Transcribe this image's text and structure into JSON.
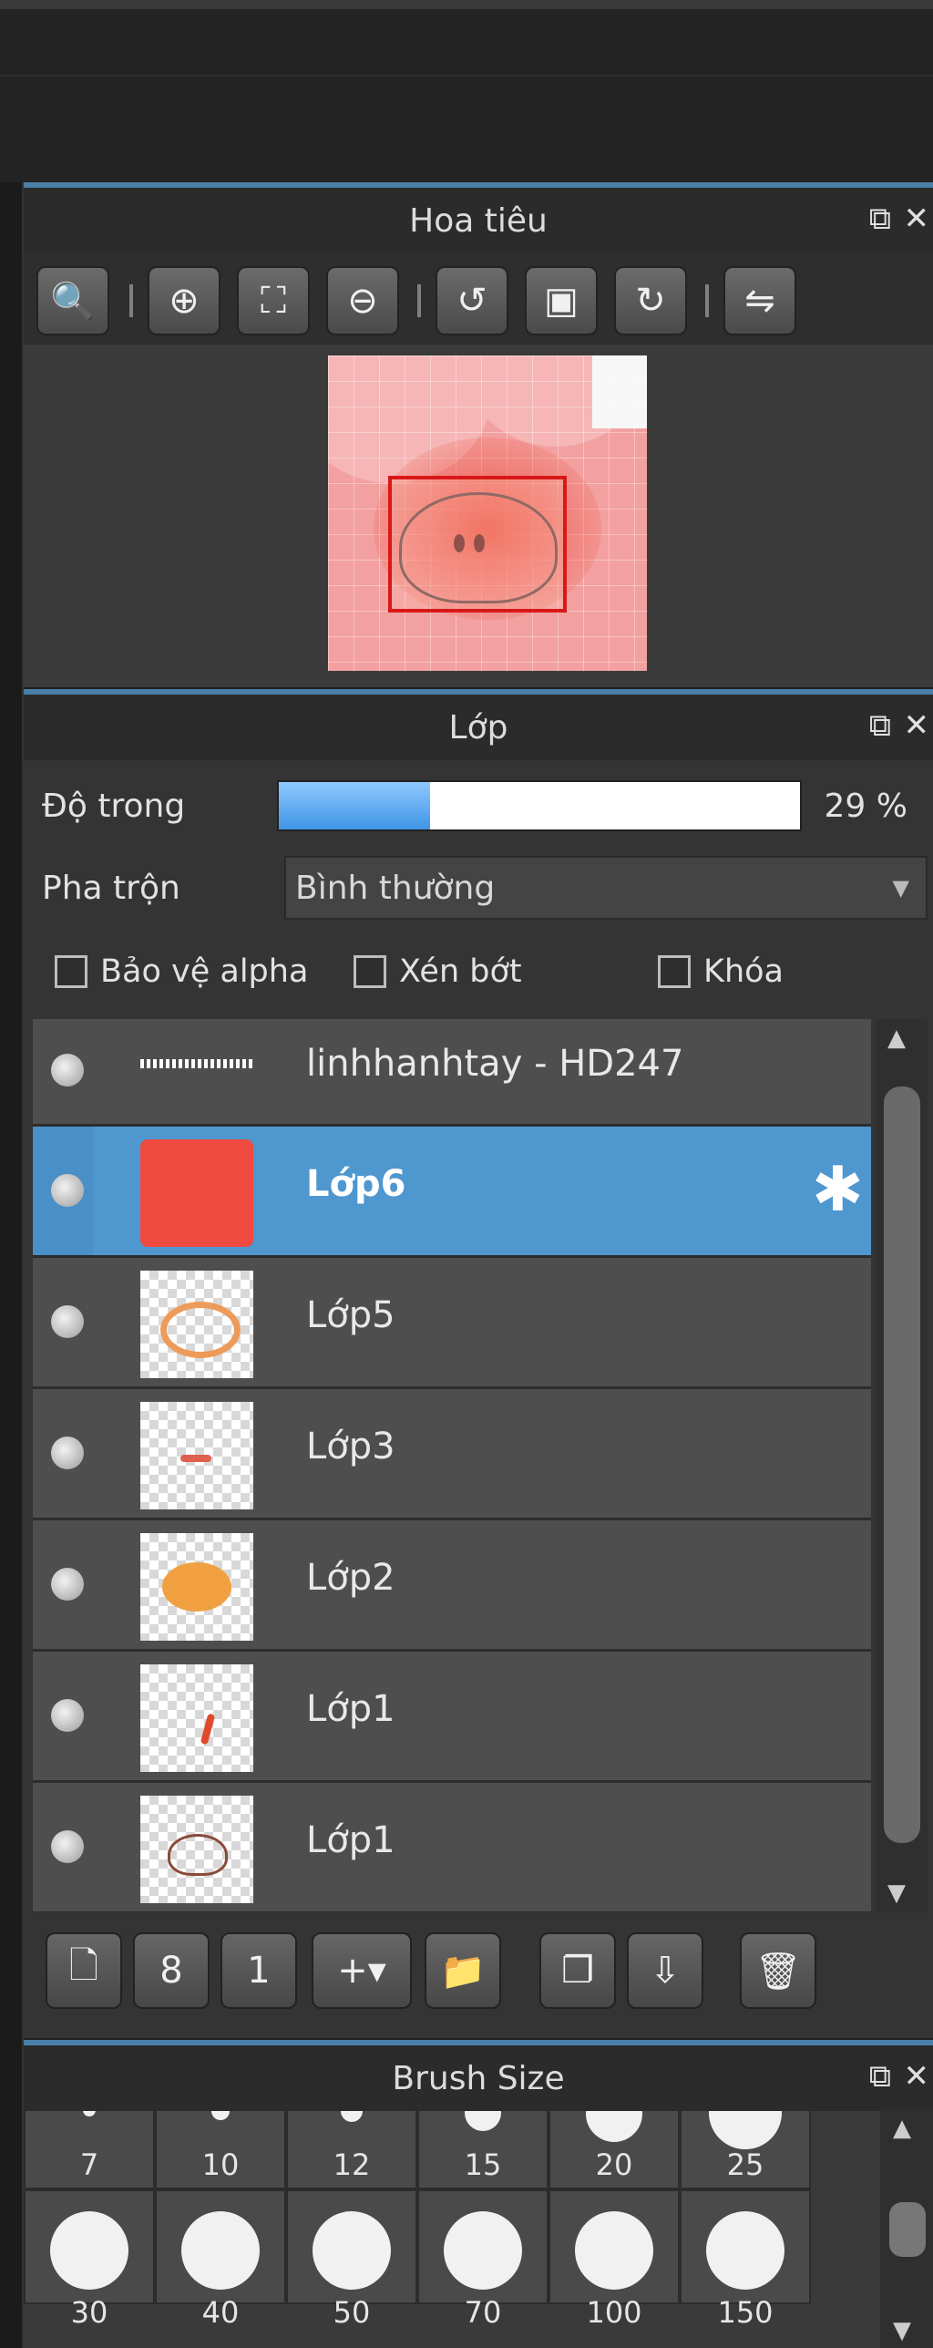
{
  "navigator": {
    "title": "Hoa tiêu",
    "toolbar": [
      {
        "name": "zoom-actual-icon",
        "glyph": "🔍"
      },
      {
        "name": "zoom-in-icon",
        "glyph": "⊕"
      },
      {
        "name": "fit-screen-icon",
        "glyph": "⛶"
      },
      {
        "name": "zoom-out-icon",
        "glyph": "⊖"
      },
      {
        "name": "rotate-left-icon",
        "glyph": "↺"
      },
      {
        "name": "reset-view-icon",
        "glyph": "▣"
      },
      {
        "name": "rotate-right-icon",
        "glyph": "↻"
      },
      {
        "name": "flip-horizontal-icon",
        "glyph": "⇋"
      }
    ]
  },
  "layers": {
    "title": "Lớp",
    "opacity_label": "Độ trong",
    "opacity_value": 0.29,
    "opacity_text": "29 %",
    "blend_label": "Pha trộn",
    "blend_value": "Bình thường",
    "checkboxes": {
      "protect_alpha": "Bảo vệ alpha",
      "clipping": "Xén bớt",
      "lock": "Khóa"
    },
    "items": [
      {
        "name": "linhhanhtay - HD247",
        "selected": false,
        "thumb": "text-strip"
      },
      {
        "name": "Lớp6",
        "selected": true,
        "thumb": "red-fill"
      },
      {
        "name": "Lớp5",
        "selected": false,
        "thumb": "orange-ring"
      },
      {
        "name": "Lớp3",
        "selected": false,
        "thumb": "red-marks"
      },
      {
        "name": "Lớp2",
        "selected": false,
        "thumb": "orange-blob"
      },
      {
        "name": "Lớp1",
        "selected": false,
        "thumb": "red-stroke"
      },
      {
        "name": "Lớp1",
        "selected": false,
        "thumb": "face-sketch"
      }
    ],
    "toolbar": [
      {
        "name": "new-layer-icon",
        "glyph": "🗋"
      },
      {
        "name": "new-8bit-layer-icon",
        "glyph": "8"
      },
      {
        "name": "new-1bit-layer-icon",
        "glyph": "1"
      },
      {
        "name": "add-layer-menu-icon",
        "glyph": "+▾"
      },
      {
        "name": "new-folder-icon",
        "glyph": "📁"
      },
      {
        "name": "duplicate-layer-icon",
        "glyph": "❐"
      },
      {
        "name": "merge-down-icon",
        "glyph": "⇩"
      },
      {
        "name": "delete-layer-icon",
        "glyph": "🗑"
      }
    ]
  },
  "brush_size": {
    "title": "Brush Size",
    "row1": [
      "7",
      "10",
      "12",
      "15",
      "20",
      "25"
    ],
    "row2": [
      "30",
      "40",
      "50",
      "70",
      "100",
      "150"
    ]
  }
}
